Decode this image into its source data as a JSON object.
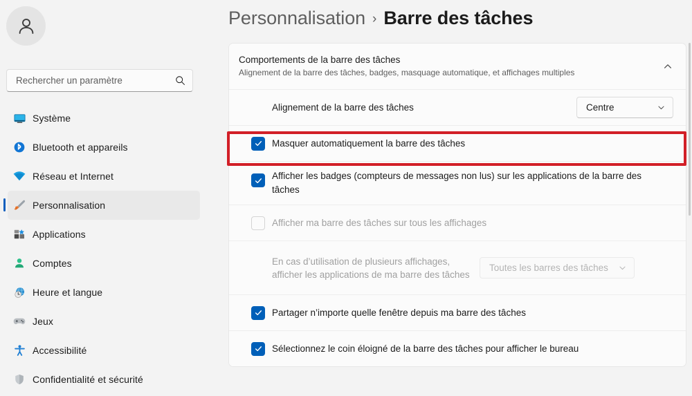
{
  "sidebar": {
    "avatar_icon": "person-avatar-icon",
    "search": {
      "placeholder": "Rechercher un paramètre",
      "value": "",
      "icon": "search-icon"
    },
    "items": [
      {
        "label": "Système",
        "icon": "monitor-icon",
        "selected": false
      },
      {
        "label": "Bluetooth et appareils",
        "icon": "bluetooth-icon",
        "selected": false
      },
      {
        "label": "Réseau et Internet",
        "icon": "wifi-icon",
        "selected": false
      },
      {
        "label": "Personnalisation",
        "icon": "paintbrush-icon",
        "selected": true
      },
      {
        "label": "Applications",
        "icon": "apps-icon",
        "selected": false
      },
      {
        "label": "Comptes",
        "icon": "account-icon",
        "selected": false
      },
      {
        "label": "Heure et langue",
        "icon": "clock-globe-icon",
        "selected": false
      },
      {
        "label": "Jeux",
        "icon": "gamepad-icon",
        "selected": false
      },
      {
        "label": "Accessibilité",
        "icon": "accessibility-icon",
        "selected": false
      },
      {
        "label": "Confidentialité et sécurité",
        "icon": "shield-icon",
        "selected": false
      }
    ]
  },
  "breadcrumb": {
    "parent": "Personnalisation",
    "separator": "›",
    "current": "Barre des tâches"
  },
  "section": {
    "title": "Comportements de la barre des tâches",
    "subtitle": "Alignement de la barre des tâches, badges, masquage automatique, et affichages multiples",
    "expanded": true,
    "collapse_icon": "chevron-up-icon"
  },
  "rows": {
    "alignment": {
      "label": "Alignement de la barre des tâches",
      "dropdown_value": "Centre",
      "dropdown_icon": "chevron-down-icon",
      "disabled": false
    },
    "autohide": {
      "label": "Masquer automatiquement la barre des tâches",
      "checked": true,
      "disabled": false,
      "highlighted": true
    },
    "badges": {
      "label": "Afficher les badges (compteurs de messages non lus) sur les applications de la barre des tâches",
      "checked": true,
      "disabled": false
    },
    "all_displays": {
      "label": "Afficher ma barre des tâches sur tous les affichages",
      "checked": false,
      "disabled": true
    },
    "multi_display_apps": {
      "label": "En cas d’utilisation de plusieurs affichages, afficher les applications de ma barre des tâches",
      "dropdown_value": "Toutes les barres des tâches",
      "dropdown_icon": "chevron-down-icon",
      "disabled": true
    },
    "share_window": {
      "label": "Partager n’importe quelle fenêtre depuis ma barre des tâches",
      "checked": true,
      "disabled": false
    },
    "show_desktop": {
      "label": "Sélectionnez le coin éloigné de la barre des tâches pour afficher le bureau",
      "checked": true,
      "disabled": false
    }
  },
  "annotation": {
    "color": "#D21F27",
    "target": "autohide-row"
  },
  "colors": {
    "accent": "#005FB8",
    "page_background": "#F3F3F3",
    "card_background": "#FBFBFB",
    "selection_indicator": "#0F5FBD",
    "annotation_red": "#D21F27"
  }
}
